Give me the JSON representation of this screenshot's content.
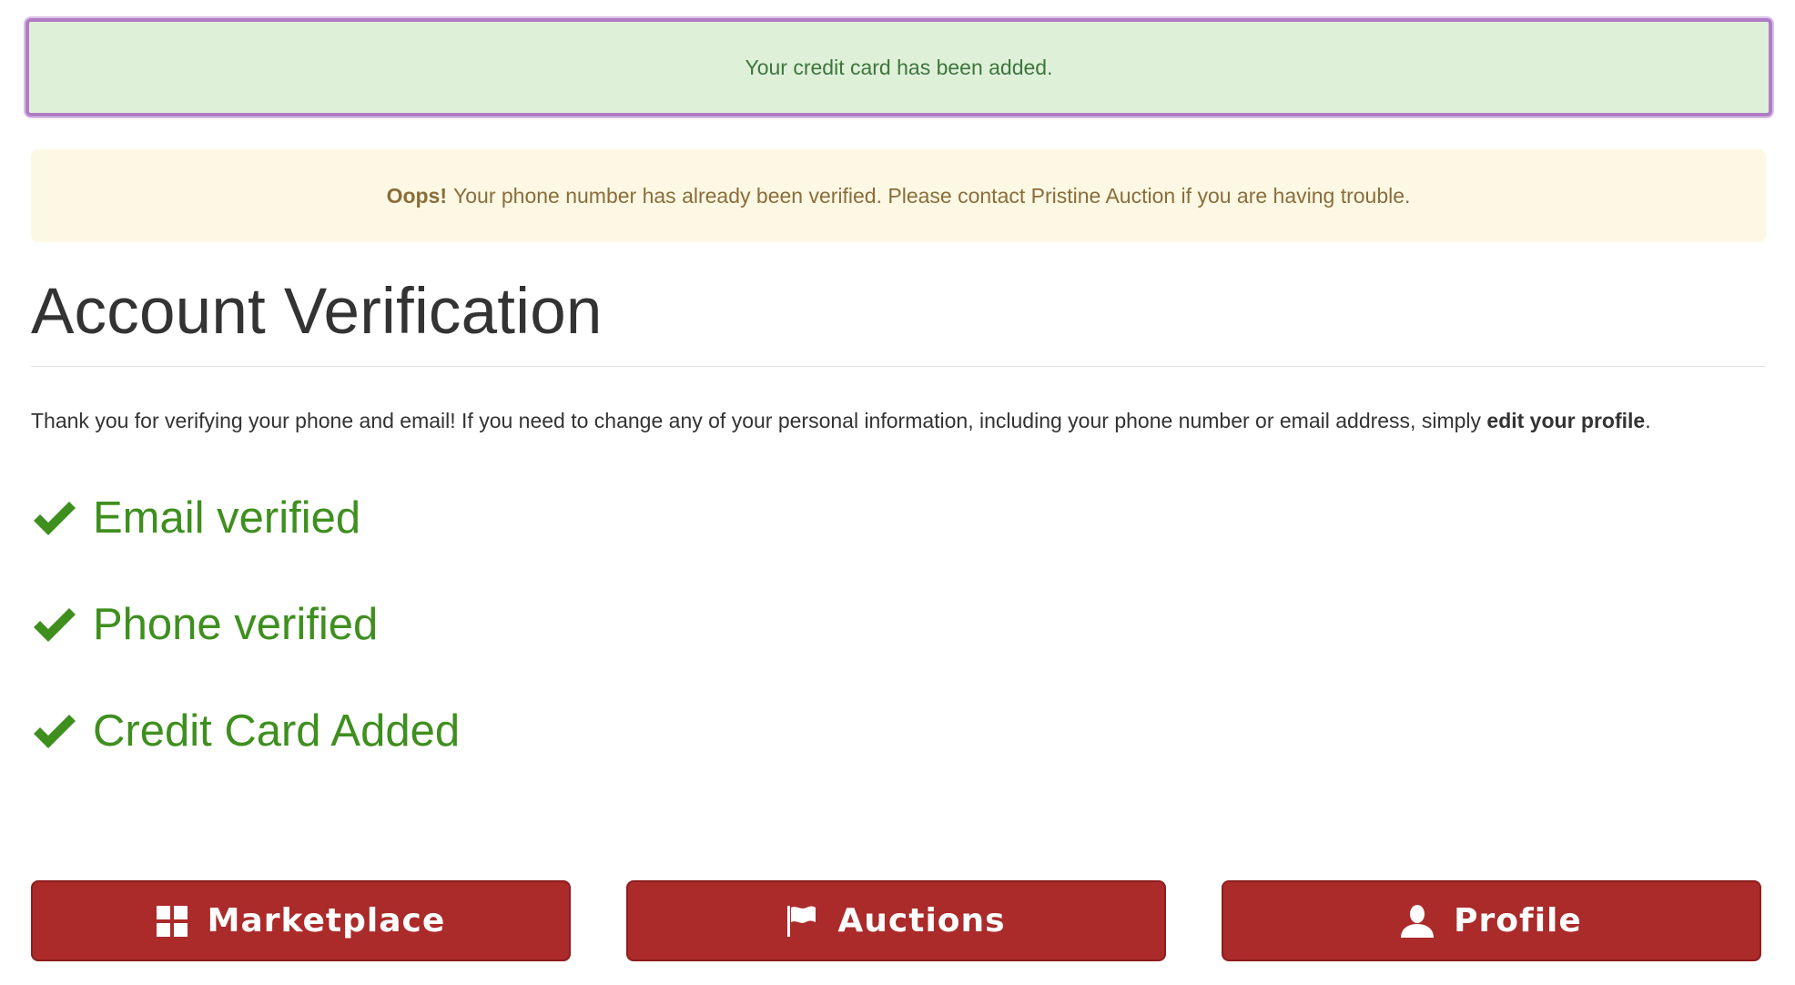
{
  "alerts": {
    "success_text": "Your credit card has been added.",
    "warning_prefix": "Oops!",
    "warning_text": "Your phone number has already been verified. Please contact Pristine Auction if you are having trouble."
  },
  "page": {
    "title": "Account Verification",
    "intro_text": "Thank you for verifying your phone and email! If you need to change any of your personal information, including your phone number or email address, simply",
    "intro_link": "edit your profile",
    "intro_end": "."
  },
  "checks": [
    {
      "label": "Email verified",
      "icon": "checkmark-icon"
    },
    {
      "label": "Phone verified",
      "icon": "checkmark-icon"
    },
    {
      "label": "Credit Card Added",
      "icon": "checkmark-icon"
    }
  ],
  "buttons": {
    "marketplace": {
      "label": "Marketplace",
      "icon": "grid-icon"
    },
    "auctions": {
      "label": "Auctions",
      "icon": "flag-icon"
    },
    "profile": {
      "label": "Profile",
      "icon": "user-icon"
    }
  },
  "colors": {
    "success_bg": "#dff0d8",
    "success_text": "#3c763d",
    "warning_bg": "#fcf8e3",
    "warning_text": "#8a6d3b",
    "verified_green": "#3f8f1f",
    "button_red": "#ab2a2a"
  }
}
